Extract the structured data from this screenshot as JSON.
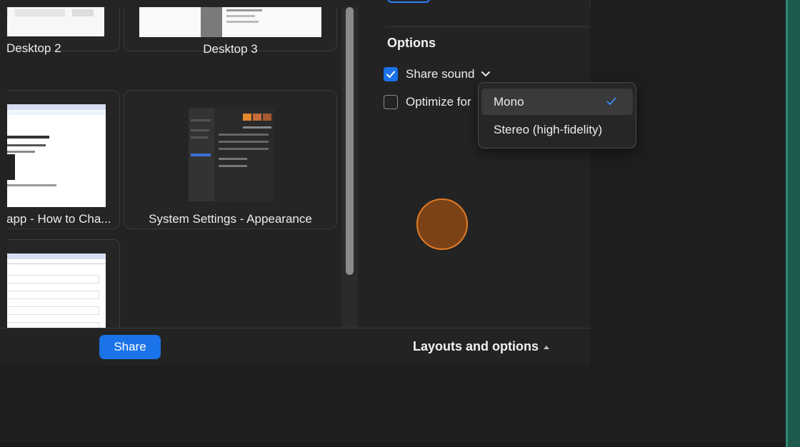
{
  "tiles": [
    {
      "label": "Desktop 2"
    },
    {
      "label": "Desktop 3"
    },
    {
      "label": "app - How to Cha..."
    },
    {
      "label": "System Settings - Appearance"
    },
    {
      "label": ""
    }
  ],
  "options": {
    "title": "Options",
    "share_sound": {
      "label": "Share sound",
      "checked": true
    },
    "optimize": {
      "label": "Optimize for",
      "checked": false
    }
  },
  "dropdown": {
    "items": [
      {
        "label": "Mono",
        "selected": true
      },
      {
        "label": "Stereo (high-fidelity)",
        "selected": false
      }
    ]
  },
  "bottom": {
    "share_label": "Share",
    "layouts_label": "Layouts and options"
  },
  "colors": {
    "accent": "#1a73e8",
    "cursor": "#e07b28"
  }
}
